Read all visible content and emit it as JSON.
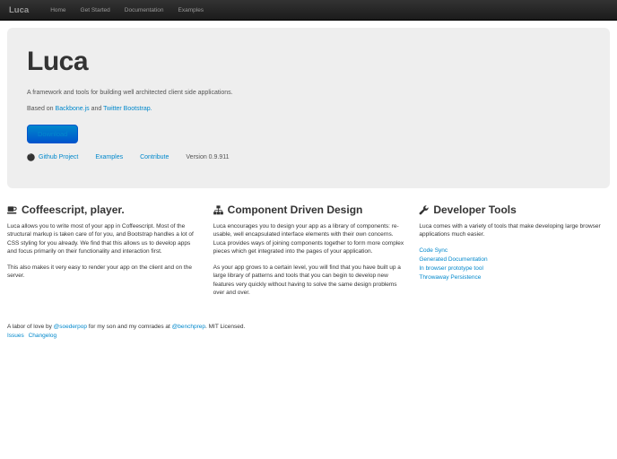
{
  "navbar": {
    "brand": "Luca",
    "items": [
      {
        "label": "Home"
      },
      {
        "label": "Get Started"
      },
      {
        "label": "Documentation"
      },
      {
        "label": "Examples"
      }
    ]
  },
  "hero": {
    "title": "Luca",
    "subtitle": "A framework and tools for building well architected client side applications.",
    "based_on": {
      "prefix": "Based on ",
      "link1": "Backbone.js",
      "middle": " and ",
      "link2": "Twitter Bootstrap."
    },
    "download_label": "Download",
    "github_icon": "github-icon",
    "links": [
      {
        "label": "Github Project"
      },
      {
        "label": "Examples"
      },
      {
        "label": "Contribute"
      }
    ],
    "version": "Version 0.9.911"
  },
  "columns": [
    {
      "icon": "coffee-mug-icon",
      "title": "Coffeescript, player.",
      "paragraphs": [
        "Luca allows you to write most of your app in Coffeescript. Most of the structural markup is taken care of for you, and Bootstrap handles a lot of CSS styling for you already. We find that this allows us to develop apps and focus primarily on their functionality and interaction first.",
        "This also makes it very easy to render your app on the client and on the server."
      ]
    },
    {
      "icon": "sitemap-icon",
      "title": "Component Driven Design",
      "paragraphs": [
        "Luca encourages you to design your app as a library of components: re-usable, well encapsulated interface elements with their own concerns. Luca provides ways of joining components together to form more complex pieces which get integrated into the pages of your application.",
        "As your app grows to a certain level, you will find that you have built up a large library of patterns and tools that you can begin to develop new features very quickly without having to solve the same design problems over and over."
      ]
    },
    {
      "icon": "wrench-icon",
      "title": "Developer Tools",
      "paragraphs": [
        "Luca comes with a variety of tools that make developing large browser applications much easier."
      ],
      "links": [
        {
          "label": "Code Sync"
        },
        {
          "label": "Generated Documentation"
        },
        {
          "label": "In browser prototype tool"
        },
        {
          "label": "Throwaway Persistence"
        }
      ]
    }
  ],
  "footer": {
    "prefix": "A labor of love by ",
    "link1": "@soederpop",
    "middle": " for my son and my comrades at ",
    "link2": "@benchprep",
    "suffix": ". MIT Licensed.",
    "links": [
      {
        "label": "Issues"
      },
      {
        "label": "Changelog"
      }
    ]
  },
  "colors": {
    "link": "#0088cc",
    "navbar_bg": "#222222",
    "hero_bg": "#eeeeee",
    "button_top": "#0088cc",
    "button_bottom": "#0055cc",
    "text": "#333333"
  }
}
